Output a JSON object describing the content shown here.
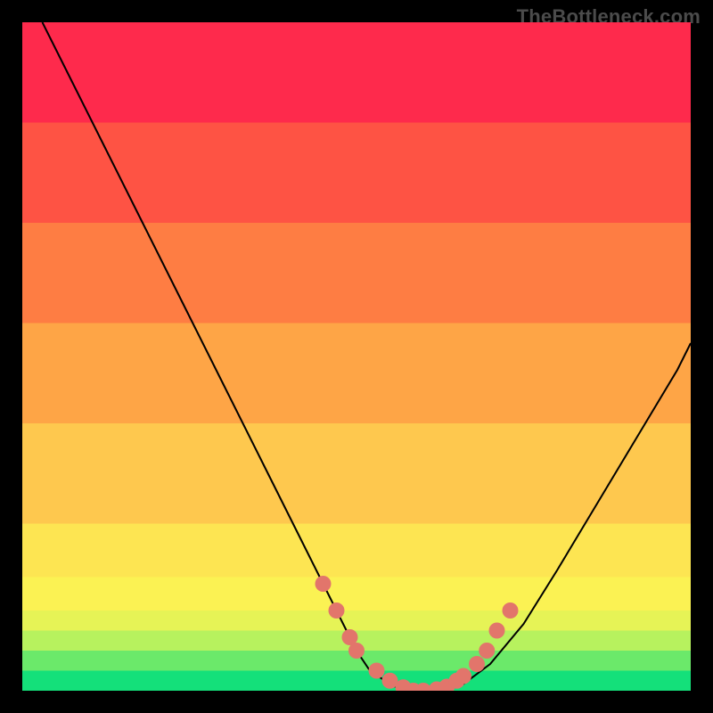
{
  "attribution": "TheBottleneck.com",
  "chart_data": {
    "type": "line",
    "title": "",
    "xlabel": "",
    "ylabel": "",
    "xlim": [
      0,
      100
    ],
    "ylim": [
      0,
      100
    ],
    "series": [
      {
        "name": "curve",
        "x": [
          3,
          8,
          12,
          18,
          24,
          30,
          36,
          42,
          45,
          48,
          50,
          52,
          55,
          57,
          60,
          63,
          66,
          70,
          75,
          80,
          86,
          92,
          98,
          100
        ],
        "y": [
          100,
          90,
          82,
          70,
          58,
          46,
          34,
          22,
          16,
          10,
          6,
          3,
          1,
          0,
          0,
          0,
          1,
          4,
          10,
          18,
          28,
          38,
          48,
          52
        ]
      }
    ],
    "markers": {
      "name": "dots",
      "color": "#e2756b",
      "x": [
        45,
        47,
        49,
        50,
        53,
        55,
        57,
        58.5,
        60,
        62,
        63.5,
        65,
        66,
        68,
        69.5,
        71,
        73
      ],
      "y": [
        16,
        12,
        8,
        6,
        3,
        1.5,
        0.5,
        0,
        0,
        0.2,
        0.6,
        1.5,
        2.2,
        4,
        6,
        9,
        12
      ]
    },
    "background_bands": [
      {
        "from_y": 0,
        "to_y": 3,
        "color": "#14e07a"
      },
      {
        "from_y": 3,
        "to_y": 6,
        "color": "#6be96a"
      },
      {
        "from_y": 6,
        "to_y": 9,
        "color": "#b7f25e"
      },
      {
        "from_y": 9,
        "to_y": 12,
        "color": "#e6f356"
      },
      {
        "from_y": 12,
        "to_y": 17,
        "color": "#fbf253"
      },
      {
        "from_y": 17,
        "to_y": 25,
        "color": "#fde552"
      },
      {
        "from_y": 25,
        "to_y": 40,
        "color": "#fec84e"
      },
      {
        "from_y": 40,
        "to_y": 55,
        "color": "#fea546"
      },
      {
        "from_y": 55,
        "to_y": 70,
        "color": "#fe7d43"
      },
      {
        "from_y": 70,
        "to_y": 85,
        "color": "#fe5344"
      },
      {
        "from_y": 85,
        "to_y": 100,
        "color": "#fe2a4c"
      }
    ]
  }
}
